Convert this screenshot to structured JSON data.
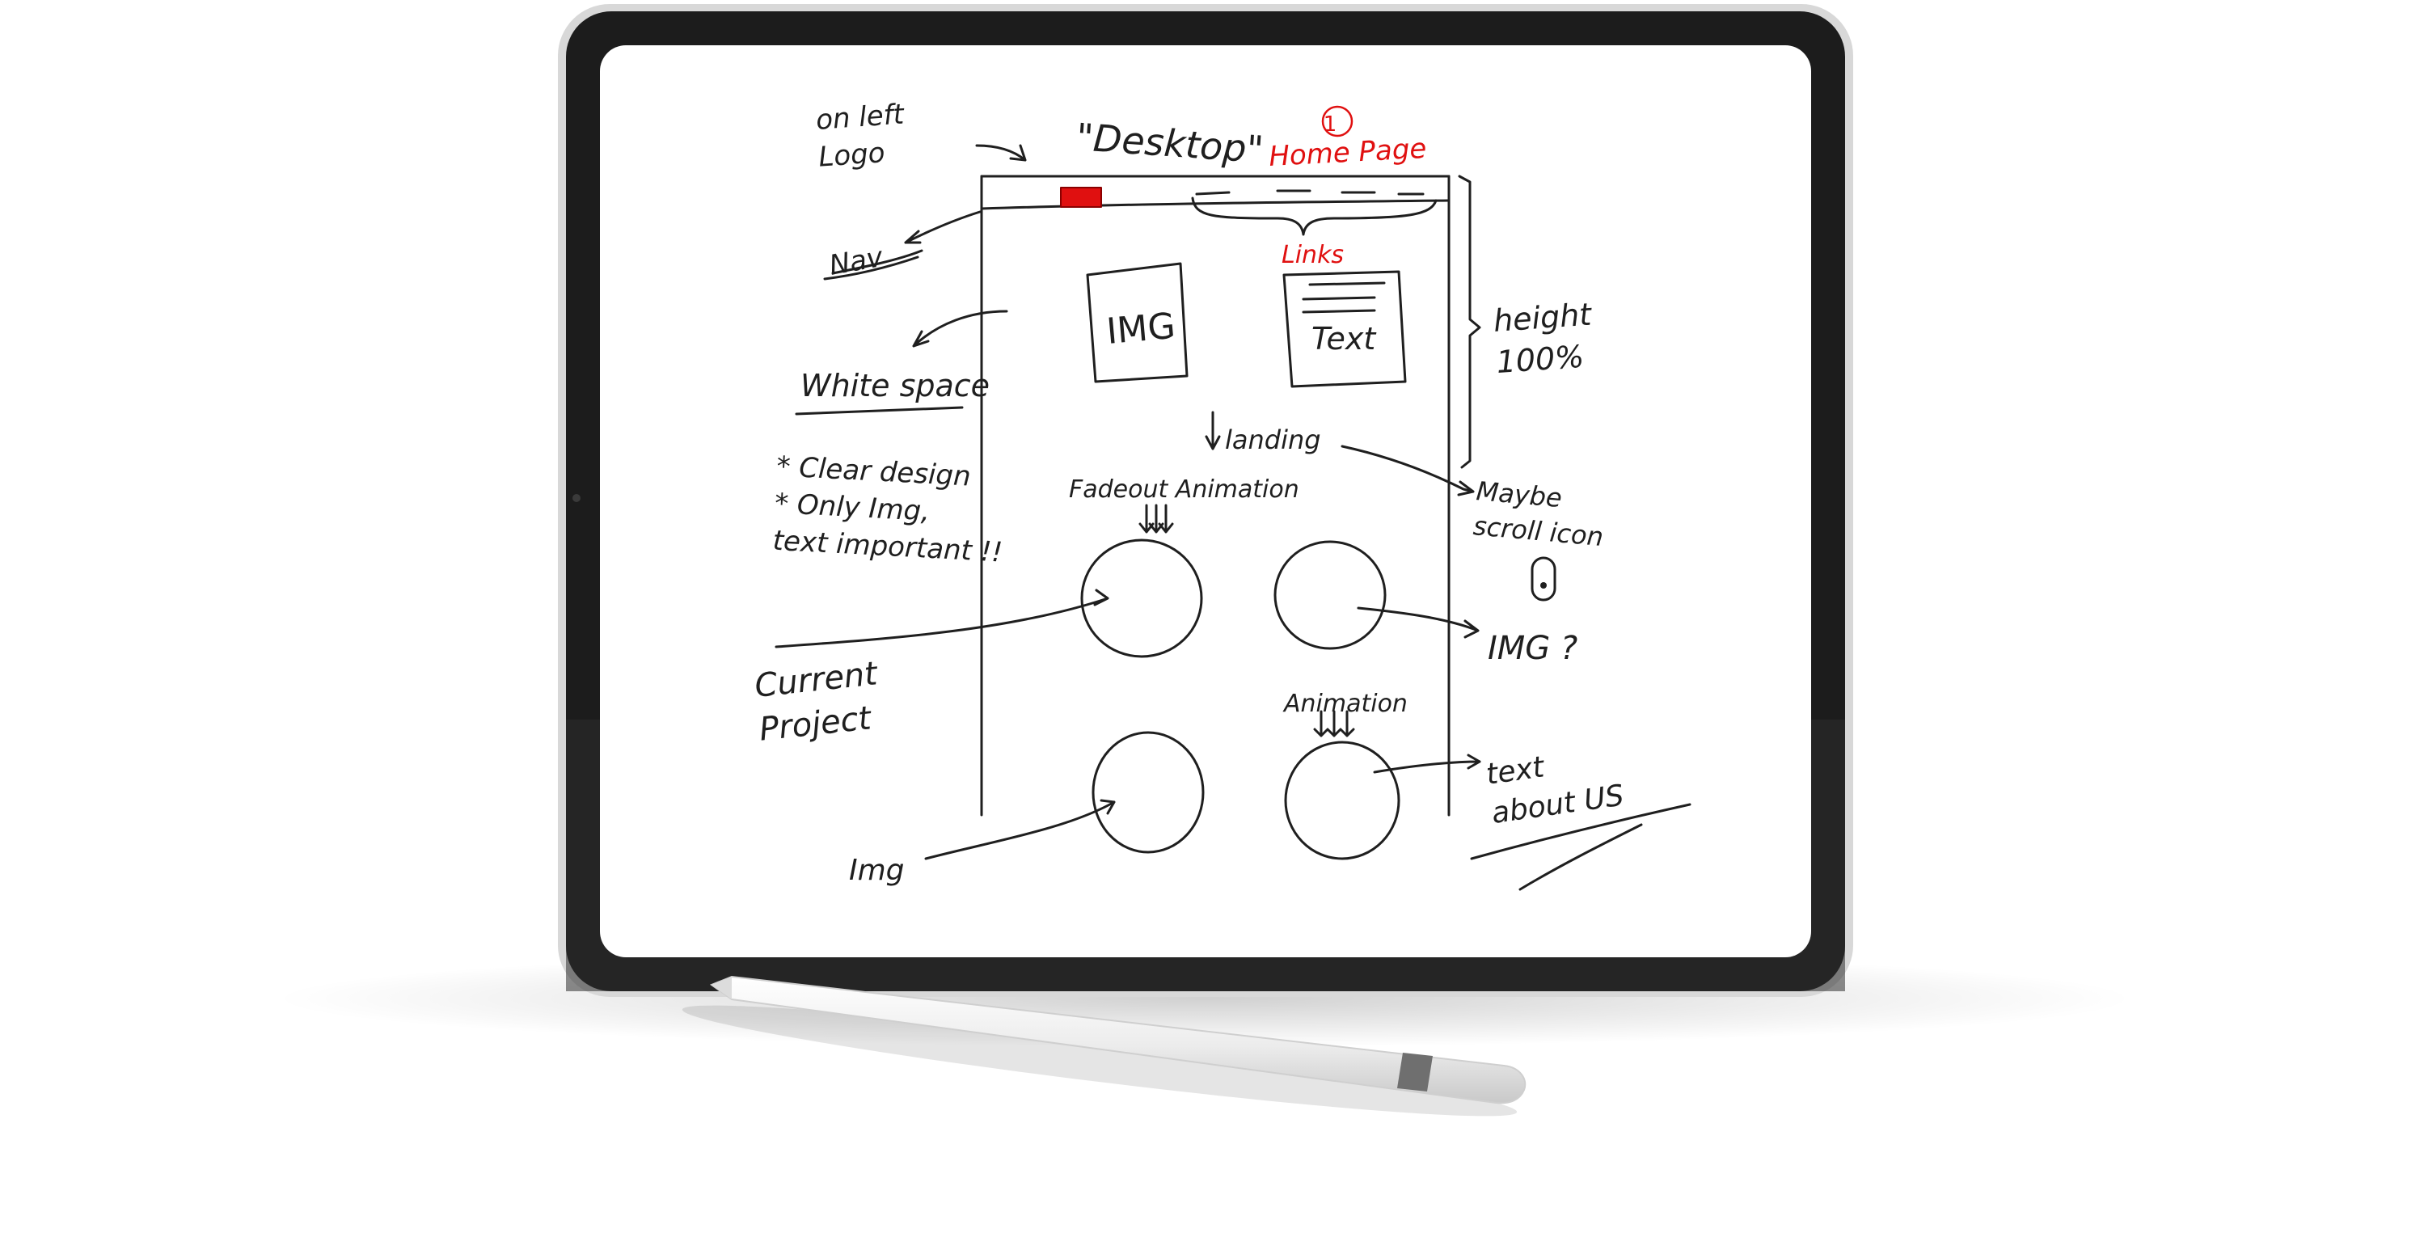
{
  "colors": {
    "ink": "#1f1f1f",
    "accent_red": "#e01010",
    "device_bezel": "#1c1c1c",
    "device_frame": "#d9d9d9",
    "screen": "#ffffff",
    "pencil_body": "#f1f1f1",
    "pencil_band": "#6f6f6f"
  },
  "sketch": {
    "label_on_left_logo": "on left\nLogo",
    "label_desktop": "\"Desktop\"",
    "label_number": "1",
    "label_home_page": "Home Page",
    "label_links": "Links",
    "label_nav": "Nav",
    "label_img_box": "IMG",
    "label_text_box": "Text",
    "label_white_space": "White space",
    "label_height": "height\n100%",
    "label_landing": "landing",
    "label_notes": "* Clear design\n* Only Img,\ntext important !!",
    "label_fadeout": "Fadeout Animation",
    "label_maybe_scroll": "Maybe\nscroll icon",
    "label_img_q": "IMG ?",
    "label_current_project": "Current\nProject",
    "label_animation": "Animation",
    "label_text_about": "text\nabout US",
    "label_img_bottom": "Img"
  },
  "icons": [
    "scroll-mouse-icon",
    "logo-placeholder-icon"
  ]
}
